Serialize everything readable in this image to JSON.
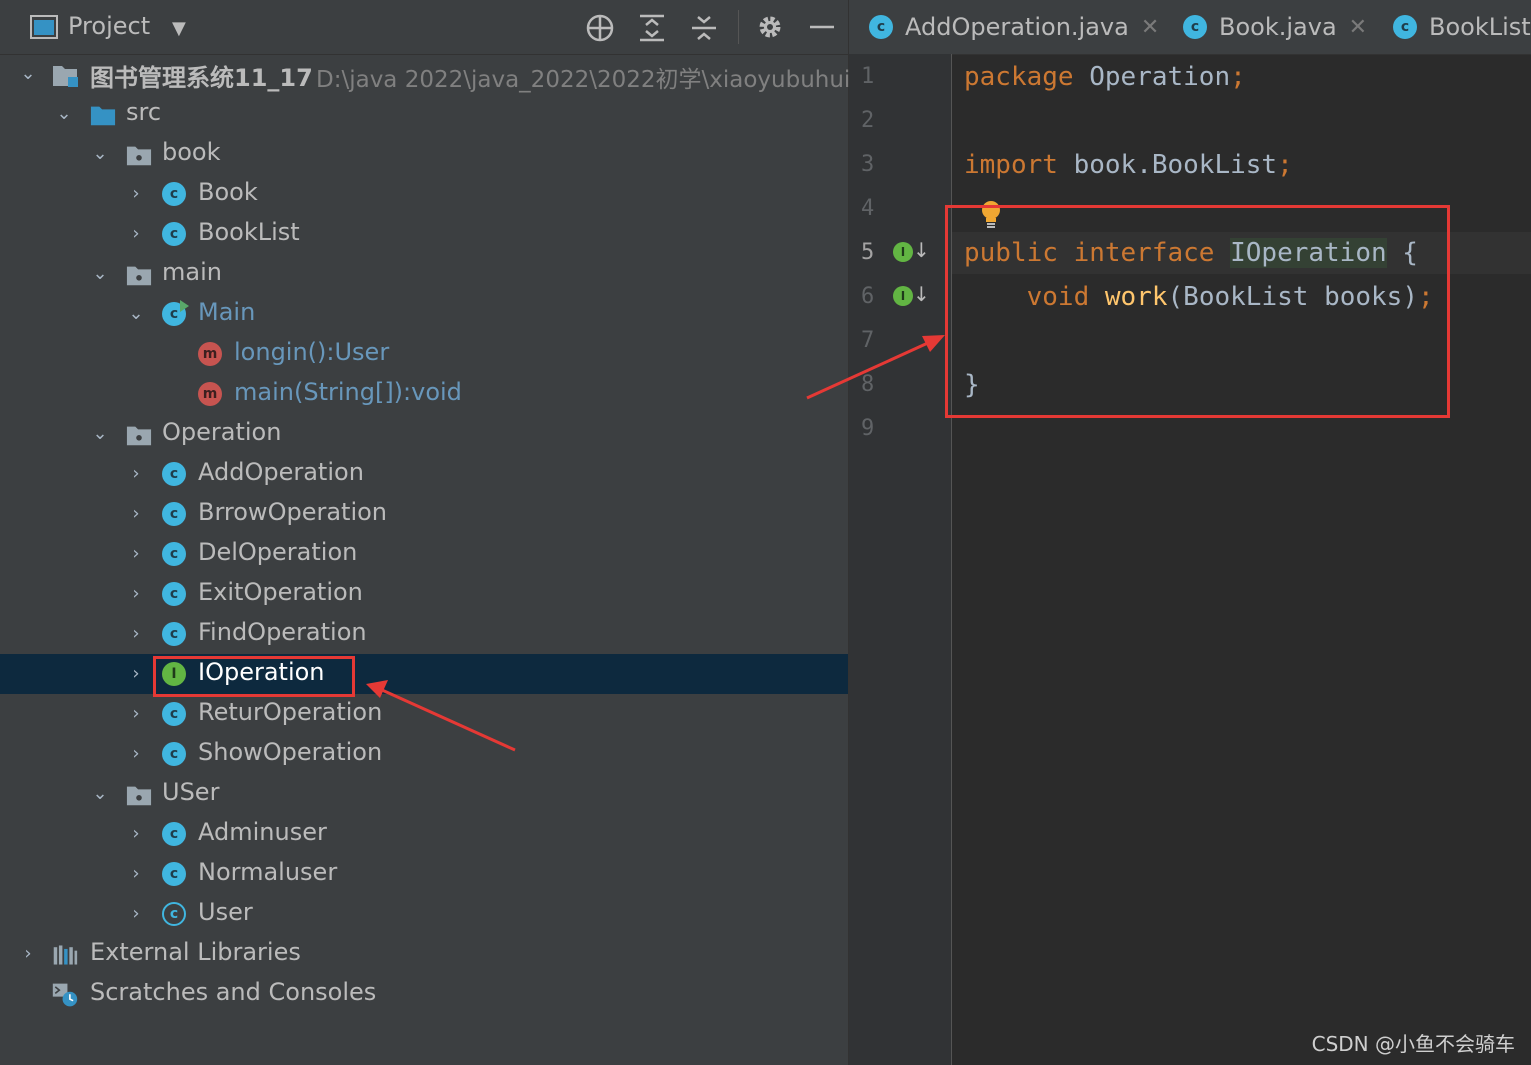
{
  "project_panel": {
    "title": "Project",
    "dropdown_glyph": "▼",
    "toolbar_icons": [
      "crosshair-icon",
      "expand-all-icon",
      "collapse-all-icon",
      "gear-icon",
      "minimize-icon"
    ]
  },
  "tree": {
    "root_name": "图书管理系统11_17",
    "root_path": "D:\\java 2022\\java_2022\\2022初学\\xiaoyubuhui",
    "src": "src",
    "book": "book",
    "book_items": [
      "Book",
      "BookList"
    ],
    "main": "main",
    "main_class": "Main",
    "main_methods": [
      "longin():User",
      "main(String[]):void"
    ],
    "operation": "Operation",
    "operation_items": [
      "AddOperation",
      "BrrowOperation",
      "DelOperation",
      "ExitOperation",
      "FindOperation",
      "IOperation",
      "ReturOperation",
      "ShowOperation"
    ],
    "user_pkg": "USer",
    "user_items": [
      "Adminuser",
      "Normaluser",
      "User"
    ],
    "external": "External Libraries",
    "scratches": "Scratches and Consoles"
  },
  "editor": {
    "tabs": [
      "AddOperation.java",
      "Book.java",
      "BookList."
    ],
    "line_numbers": [
      "1",
      "2",
      "3",
      "4",
      "5",
      "6",
      "7",
      "8",
      "9"
    ],
    "code": {
      "l1_kw": "package",
      "l1_rest": " Operation",
      "l1_semi": ";",
      "l3_kw": "import",
      "l3_rest": " book.BookList",
      "l3_semi": ";",
      "l5_kw": "public interface",
      "l5_name": "IOperation",
      "l5_brace": " {",
      "l6_kw": "void",
      "l6_fn": "work",
      "l6_rest": "(BookList books)",
      "l6_semi": ";",
      "l8": "}"
    }
  },
  "watermark": "CSDN @小鱼不会骑车",
  "colors": {
    "panel_bg": "#3c3f41",
    "editor_bg": "#2b2b2b",
    "selection": "#0d293e",
    "keyword": "#cc7832",
    "annotation_red": "#e53935"
  }
}
